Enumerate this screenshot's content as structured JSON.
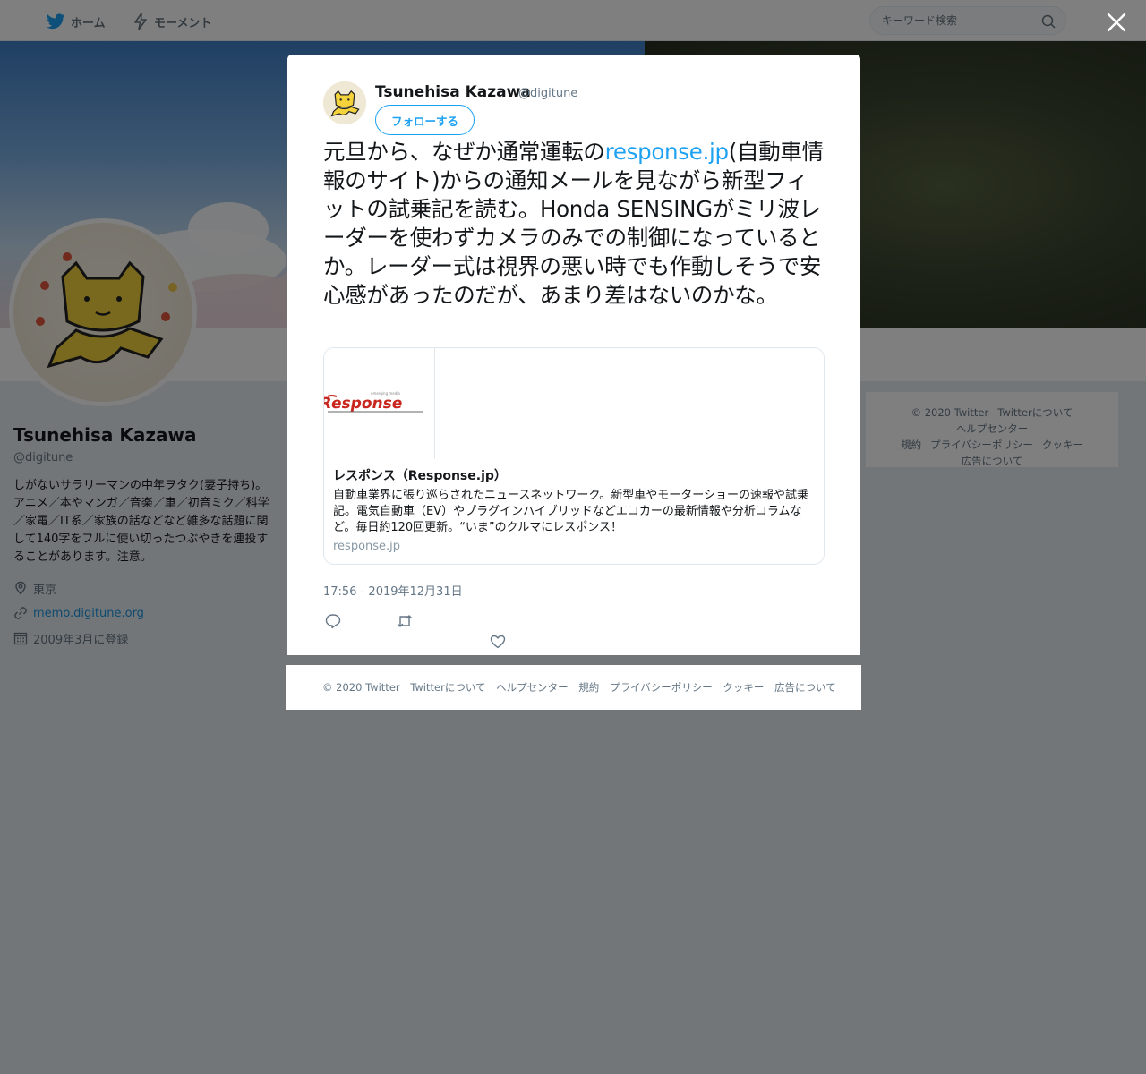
{
  "nav": {
    "home": "ホーム",
    "moments": "モーメント",
    "search_placeholder": "キーワード検索"
  },
  "profile": {
    "name": "Tsunehisa Kazawa",
    "handle": "@digitune",
    "bio": "しがないサラリーマンの中年ヲタク(妻子持ち)。アニメ／本やマンガ／音楽／車／初音ミク／科学／家電／IT系／家族の話などなど雑多な話題に関して140字をフルに使い切ったつぶやきを連投することがあります。注意。",
    "location": "東京",
    "url": "memo.digitune.org",
    "joined": "2009年3月に登録"
  },
  "side_footer": [
    "© 2020 Twitter",
    "Twitterについて",
    "ヘルプセンター",
    "規約",
    "プライバシーポリシー",
    "クッキー",
    "広告について"
  ],
  "tweet": {
    "name": "Tsunehisa Kazawa",
    "handle": "@digitune",
    "follow_label": "フォローする",
    "text_before": "元旦から、なぜか通常運転の",
    "link_text": "response.jp",
    "text_after": "(自動車情報のサイト)からの通知メールを見ながら新型フィットの試乗記を読む。Honda SENSINGがミリ波レーダーを使わずカメラのみでの制御になっているとか。レーダー式は視界の悪い時でも作動しそうで安心感があったのだが、あまり差はないのかな。",
    "timestamp": "17:56 - 2019年12月31日",
    "card": {
      "title": "レスポンス（Response.jp）",
      "description": "自動車業界に張り巡らされたニュースネットワーク。新型車やモーターショーの速報や試乗記。電気自動車（EV）やプラグインハイブリッドなどエコカーの最新情報や分析コラムなど。毎日約120回更新。“いま”のクルマにレスポンス！",
      "domain": "response.jp",
      "logo_text": "Response",
      "logo_tagline": "emerging media"
    }
  },
  "modal_footer": [
    "© 2020 Twitter",
    "Twitterについて",
    "ヘルプセンター",
    "規約",
    "プライバシーポリシー",
    "クッキー",
    "広告について"
  ],
  "colors": {
    "accent": "#1da1f2",
    "link": "#1b95e0",
    "overlay": "rgba(0,0,0,0.5)",
    "logo_red": "#c8261e"
  }
}
